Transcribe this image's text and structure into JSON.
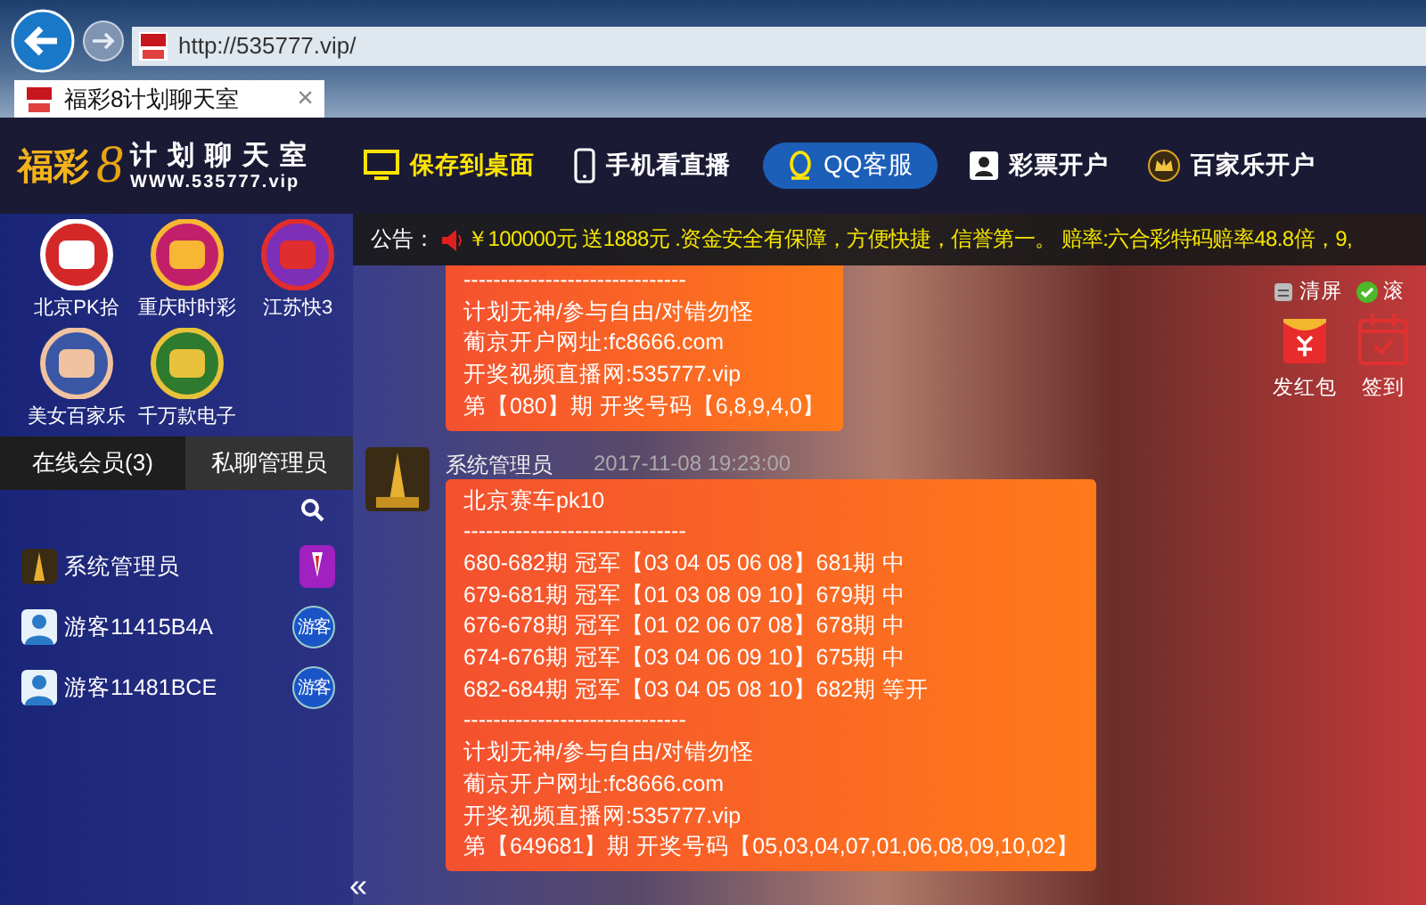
{
  "browser": {
    "address": "http://535777.vip/",
    "tab": {
      "title": "福彩8计划聊天室",
      "close": "×"
    }
  },
  "header": {
    "logo": {
      "brand": "福彩",
      "digit": "8",
      "name": "计划聊天室",
      "url": "WWW.535777.vip"
    },
    "nav": [
      {
        "label": "保存到桌面",
        "kind": "desktop"
      },
      {
        "label": "手机看直播",
        "kind": "mobile"
      },
      {
        "label": "QQ客服",
        "kind": "qq"
      },
      {
        "label": "彩票开户",
        "kind": "account"
      },
      {
        "label": "百家乐开户",
        "kind": "baccarat"
      }
    ]
  },
  "sidebar": {
    "games": [
      {
        "label": "北京PK拾"
      },
      {
        "label": "重庆时时彩"
      },
      {
        "label": "江苏快3"
      },
      {
        "label": "美女百家乐"
      },
      {
        "label": "千万款电子"
      }
    ],
    "tabs": [
      {
        "label": "在线会员(3)",
        "selected": true
      },
      {
        "label": "私聊管理员",
        "selected": false
      }
    ],
    "members": [
      {
        "name": "系统管理员",
        "kind": "admin"
      },
      {
        "name": "游客11415B4A",
        "kind": "guest",
        "badge": "游客"
      },
      {
        "name": "游客11481BCE",
        "kind": "guest",
        "badge": "游客"
      }
    ],
    "collapse": "«"
  },
  "notice": {
    "label": "公告：",
    "text": "￥100000元 送1888元 .资金安全有保障，方便快捷，信誉第一。 赔率:六合彩特码赔率48.8倍，9,"
  },
  "messages": [
    {
      "lines": [
        "------------------------------",
        "计划无神/参与自由/对错勿怪",
        "葡京开户网址:fc8666.com",
        "开奖视频直播网:535777.vip",
        "第【080】期 开奖号码【6,8,9,4,0】"
      ]
    },
    {
      "sender": "系统管理员",
      "time": "2017-11-08 19:23:00",
      "lines": [
        "北京赛车pk10",
        "------------------------------",
        "680-682期 冠军【03 04 05 06 08】681期 中",
        "679-681期 冠军【01 03 08 09 10】679期 中",
        "676-678期 冠军【01 02 06 07 08】678期 中",
        "674-676期 冠军【03 04 06 09 10】675期 中",
        "682-684期 冠军【03 04 05 08 10】682期 等开",
        "------------------------------",
        "计划无神/参与自由/对错勿怪",
        "葡京开户网址:fc8666.com",
        "开奖视频直播网:535777.vip",
        "第【649681】期 开奖号码【05,03,04,07,01,06,08,09,10,02】"
      ]
    }
  ],
  "tools": {
    "clear": {
      "label": "清屏"
    },
    "scroll": {
      "label": "滚",
      "checked": true
    },
    "red_packet": {
      "label": "发红包"
    },
    "sign_in": {
      "label": "签到"
    }
  }
}
